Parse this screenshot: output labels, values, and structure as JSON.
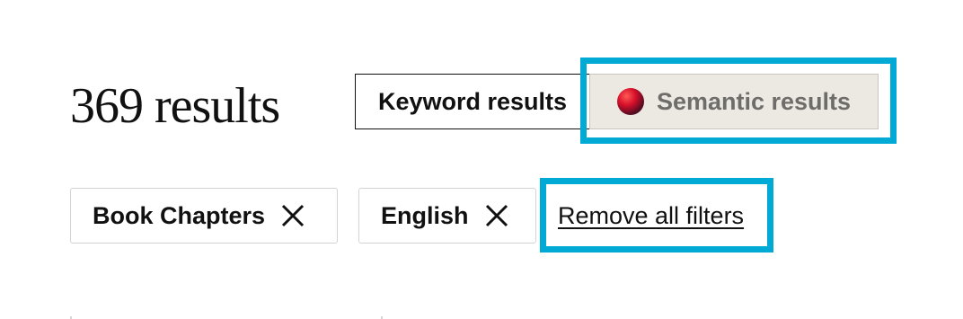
{
  "results": {
    "count_text": "369 results"
  },
  "search_mode": {
    "options": [
      {
        "label": "Keyword results",
        "selected": false
      },
      {
        "label": "Semantic results",
        "selected": true,
        "icon": "semantic-orb-icon"
      }
    ],
    "selected_background": "#ece9e3",
    "selected_text_color": "#6f6d6a"
  },
  "filters": {
    "active": [
      {
        "label": "Book Chapters",
        "icon": "close-icon"
      },
      {
        "label": "English",
        "icon": "close-icon"
      }
    ],
    "remove_all_label": "Remove all filters"
  },
  "annotation": {
    "highlight_color": "#00aad4"
  }
}
